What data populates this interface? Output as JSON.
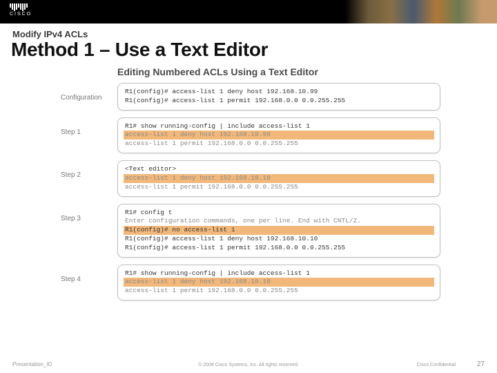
{
  "logo_text": "CISCO",
  "pretitle": "Modify IPv4 ACLs",
  "title": "Method 1 – Use a Text Editor",
  "subtitle": "Editing Numbered ACLs Using a Text Editor",
  "rows": {
    "config": {
      "label": "Configuration",
      "lines": [
        "R1(config)# access-list 1 deny host 192.168.10.99",
        "R1(config)# access-list 1 permit 192.168.0.0 0.0.255.255"
      ]
    },
    "step1": {
      "label": "Step 1",
      "head": "R1# show running-config | include access-list 1",
      "hl": "access-list 1 deny host 192.168.10.99",
      "tail": "access-list 1 permit 192.168.0.0 0.0.255.255"
    },
    "step2": {
      "label": "Step 2",
      "head": "<Text editor>",
      "hl": "access-list 1 deny host 192.168.10.10",
      "tail": "access-list 1 permit 192.168.0.0 0.0.255.255"
    },
    "step3": {
      "label": "Step 3",
      "l1": "R1# config t",
      "l2": "Enter configuration commands, one per line. End with CNTL/Z.",
      "l3": "R1(config)# no access-list 1",
      "l4": "R1(config)# access-list 1 deny host 192.168.10.10",
      "l5": "R1(config)# access-list 1 permit 192.168.0.0 0.0.255.255"
    },
    "step4": {
      "label": "Step 4",
      "head": "R1# show running-config | include access-list 1",
      "hl": "access-list 1 deny host 192.168.10.10",
      "tail": "access-list 1 permit 192.168.0.0 0.0.255.255"
    }
  },
  "footer": {
    "pid": "Presentation_ID",
    "copy": "© 2008 Cisco Systems, Inc. All rights reserved.",
    "conf": "Cisco Confidential",
    "num": "27"
  }
}
